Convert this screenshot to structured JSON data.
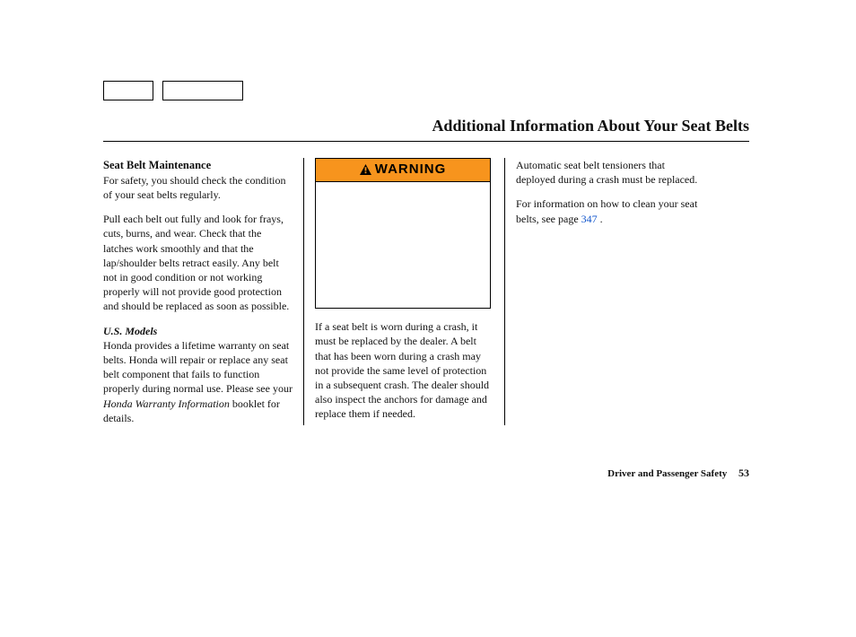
{
  "title": "Additional Information About Your Seat Belts",
  "col1": {
    "heading": "Seat Belt Maintenance",
    "p1": "For safety, you should check the condition of your seat belts regularly.",
    "p2": "Pull each belt out fully and look for frays, cuts, burns, and wear. Check that the latches work smoothly and that the lap/shoulder belts retract easily. Any belt not in good condition or not working properly will not provide good protection and should be replaced as soon as possible.",
    "sub": "U.S. Models",
    "p3a": "Honda provides a lifetime warranty on seat belts. Honda will repair or replace any seat belt component that fails to function properly during normal use. Please see your ",
    "p3b": "Honda Warranty Information",
    "p3c": " booklet for details."
  },
  "col2": {
    "warning_label": "WARNING",
    "p1": "If a seat belt is worn during a crash, it must be replaced by the dealer. A belt that has been worn during a crash may not provide the same level of protection in a subsequent crash. The dealer should also inspect the anchors for damage and replace them if needed."
  },
  "col3": {
    "p1": "Automatic seat belt tensioners that deployed during a crash must be replaced.",
    "p2a": "For information on how to clean your seat belts, see page ",
    "p2link": "347",
    "p2b": " ."
  },
  "footer": {
    "section": "Driver and Passenger Safety",
    "page": "53"
  }
}
